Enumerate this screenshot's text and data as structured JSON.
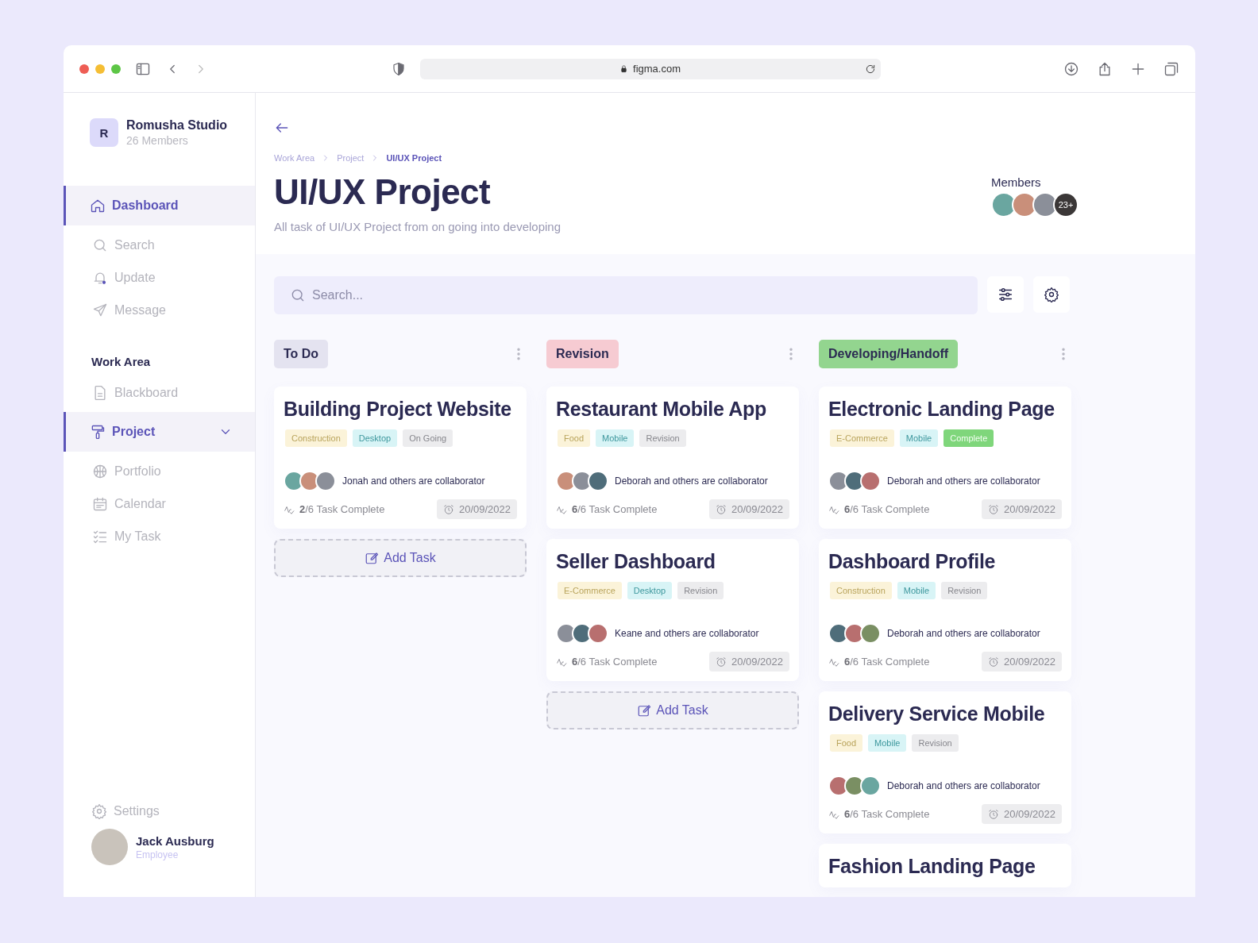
{
  "browser": {
    "url": "figma.com"
  },
  "workspace": {
    "initial": "R",
    "name": "Romusha Studio",
    "members": "26 Members"
  },
  "nav": [
    {
      "label": "Dashboard",
      "selected": true
    },
    {
      "label": "Search",
      "selected": false
    },
    {
      "label": "Update",
      "selected": false
    },
    {
      "label": "Message",
      "selected": false
    }
  ],
  "work_area": {
    "title": "Work Area",
    "items": [
      {
        "label": "Blackboard",
        "selected": false
      },
      {
        "label": "Project",
        "selected": true,
        "expanded": true
      },
      {
        "label": "Portfolio",
        "selected": false
      },
      {
        "label": "Calendar",
        "selected": false
      },
      {
        "label": "My Task",
        "selected": false
      }
    ]
  },
  "settings": {
    "label": "Settings"
  },
  "user": {
    "name": "Jack Ausburg",
    "role": "Employee"
  },
  "breadcrumb": [
    {
      "label": "Work Area",
      "selected": false
    },
    {
      "label": "Project",
      "selected": false
    },
    {
      "label": "UI/UX Project",
      "selected": true
    }
  ],
  "page": {
    "title": "UI/UX Project",
    "subtitle": "All task of UI/UX Project from on going into developing"
  },
  "members": {
    "label": "Members",
    "more": "23+"
  },
  "search": {
    "placeholder": "Search..."
  },
  "columns": [
    {
      "title": "To Do",
      "color": "#e4e3f0",
      "add_label": "Add Task",
      "cards": [
        {
          "title": "Building Project Website",
          "tags": [
            {
              "label": "Construction",
              "kind": "category"
            },
            {
              "label": "Desktop",
              "kind": "platform"
            },
            {
              "label": "On Going",
              "kind": "status"
            }
          ],
          "collaborators": "Jonah and others are collaborator",
          "progress": "**2**/6 Task Complete",
          "date": "20/09/2022"
        }
      ]
    },
    {
      "title": "Revision",
      "color": "#f6cbd2",
      "add_label": "Add Task",
      "cards": [
        {
          "title": "Restaurant Mobile App",
          "tags": [
            {
              "label": "Food",
              "kind": "category"
            },
            {
              "label": "Mobile",
              "kind": "platform"
            },
            {
              "label": "Revision",
              "kind": "status"
            }
          ],
          "collaborators": "Deborah and others are collaborator",
          "progress": "**6**/6 Task Complete",
          "date": "20/09/2022"
        },
        {
          "title": "Seller Dashboard",
          "tags": [
            {
              "label": "E-Commerce",
              "kind": "category"
            },
            {
              "label": "Desktop",
              "kind": "platform"
            },
            {
              "label": "Revision",
              "kind": "status"
            }
          ],
          "collaborators": "Keane and others are collaborator",
          "progress": "**6**/6 Task Complete",
          "date": "20/09/2022"
        }
      ]
    },
    {
      "title": "Developing/Handoff",
      "color": "#93d58f",
      "cards": [
        {
          "title": "Electronic Landing Page",
          "tags": [
            {
              "label": "E-Commerce",
              "kind": "category"
            },
            {
              "label": "Mobile",
              "kind": "platform"
            },
            {
              "label": "Complete",
              "kind": "done"
            }
          ],
          "collaborators": "Deborah and others are collaborator",
          "progress": "**6**/6 Task Complete",
          "date": "20/09/2022"
        },
        {
          "title": "Dashboard Profile",
          "tags": [
            {
              "label": "Construction",
              "kind": "category"
            },
            {
              "label": "Mobile",
              "kind": "platform"
            },
            {
              "label": "Revision",
              "kind": "status"
            }
          ],
          "collaborators": "Deborah and others are collaborator",
          "progress": "**6**/6 Task Complete",
          "date": "20/09/2022"
        },
        {
          "title": "Delivery Service Mobile",
          "tags": [
            {
              "label": "Food",
              "kind": "category"
            },
            {
              "label": "Mobile",
              "kind": "platform"
            },
            {
              "label": "Revision",
              "kind": "status"
            }
          ],
          "collaborators": "Deborah and others are collaborator",
          "progress": "**6**/6 Task Complete",
          "date": "20/09/2022"
        },
        {
          "title": "Fashion Landing Page"
        }
      ]
    }
  ]
}
